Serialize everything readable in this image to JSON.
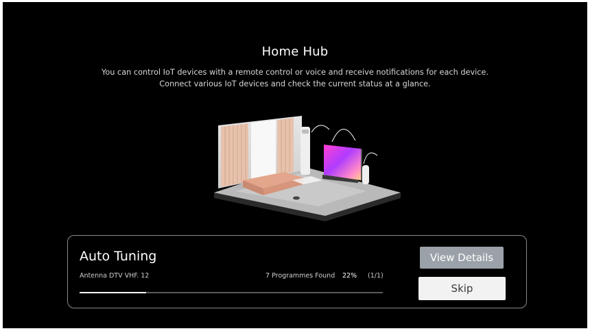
{
  "home_hub": {
    "title": "Home Hub",
    "description_line1": "You can control IoT devices with a remote control or voice and receive notifications for each device.",
    "description_line2": "Connect various IoT devices and check the current status at a glance."
  },
  "auto_tuning": {
    "title": "Auto Tuning",
    "channel": "Antenna DTV VHF. 12",
    "programmes_found": "7 Programmes Found",
    "progress_label": "22%",
    "progress_fraction": 0.22,
    "page_count": "(1/1)"
  },
  "buttons": {
    "view_details": "View Details",
    "skip": "Skip"
  },
  "colors": {
    "background": "#000000",
    "view_details_bg": "#9aa1a8",
    "skip_bg": "#f2f2f2"
  }
}
